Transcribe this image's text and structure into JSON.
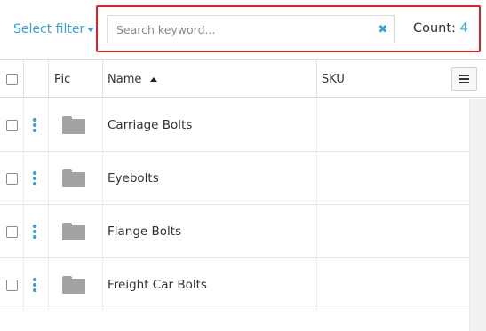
{
  "toolbar": {
    "filter_label": "Select filter",
    "search_placeholder": "Search keyword...",
    "search_value": "",
    "clear_symbol": "✖",
    "count_label": "Count:",
    "count_value": "4"
  },
  "grid": {
    "columns": {
      "pic": "Pic",
      "name": "Name",
      "sku": "SKU"
    },
    "sort": {
      "column": "name",
      "direction": "asc"
    },
    "rows": [
      {
        "name": "Carriage Bolts",
        "sku": ""
      },
      {
        "name": "Eyebolts",
        "sku": ""
      },
      {
        "name": "Flange Bolts",
        "sku": ""
      },
      {
        "name": "Freight Car Bolts",
        "sku": ""
      }
    ]
  },
  "icons": {
    "row_actions": "kebab-vertical-icon",
    "picture": "folder-icon",
    "column_menu": "hamburger-menu-icon"
  },
  "colors": {
    "accent": "#3aa0d6",
    "highlight_border": "#d6262c",
    "folder": "#a3a3a3"
  }
}
